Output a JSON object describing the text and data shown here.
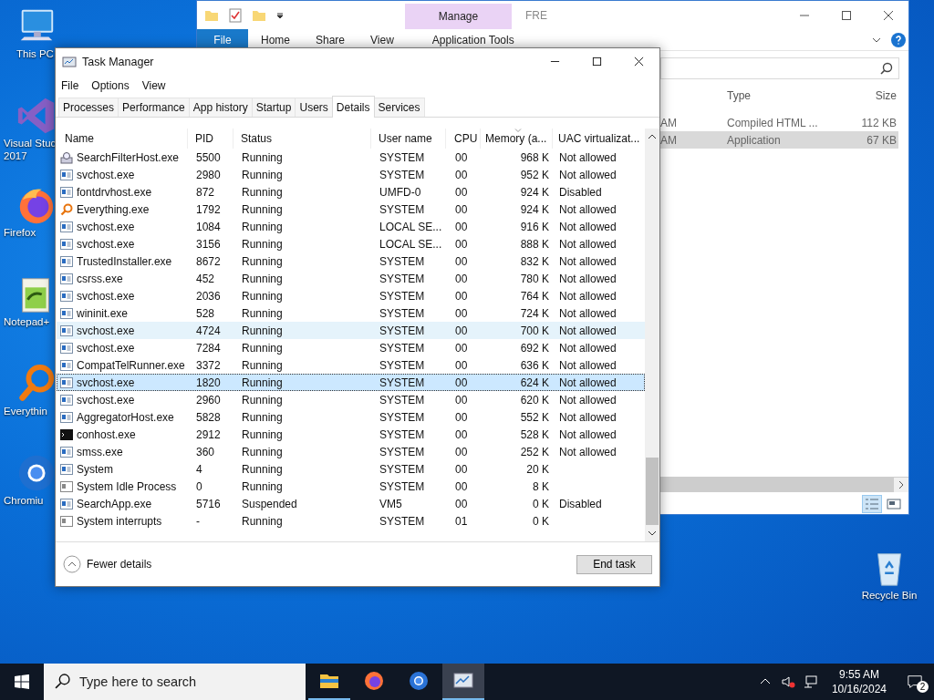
{
  "desktop_icons": [
    {
      "lines": [
        "This PC"
      ]
    },
    {
      "lines": [
        "Visual Stud",
        "2017"
      ]
    },
    {
      "lines": [
        "Firefox"
      ]
    },
    {
      "lines": [
        "Notepad+"
      ]
    },
    {
      "lines": [
        "Everythin"
      ]
    },
    {
      "lines": [
        "Chromiu"
      ]
    }
  ],
  "recycle_bin": {
    "label": "Recycle Bin"
  },
  "explorer": {
    "title": "FRE",
    "contextual_tab": "Manage",
    "ribbon_tabs": [
      {
        "label": "File",
        "kind": "file"
      },
      {
        "label": "Home",
        "kind": "plain"
      },
      {
        "label": "Share",
        "kind": "plain"
      },
      {
        "label": "View",
        "kind": "plain"
      },
      {
        "label": "Application Tools",
        "kind": "contextual"
      }
    ],
    "columns": [
      "Type",
      "Size"
    ],
    "rows": [
      {
        "modified": "AM",
        "type": "Compiled HTML ...",
        "size": "112 KB",
        "selected": false
      },
      {
        "modified": "AM",
        "type": "Application",
        "size": "67 KB",
        "selected": true
      }
    ]
  },
  "task_manager": {
    "title": "Task Manager",
    "menu": [
      "File",
      "Options",
      "View"
    ],
    "tabs": [
      {
        "label": "Processes",
        "selected": false
      },
      {
        "label": "Performance",
        "selected": false
      },
      {
        "label": "App history",
        "selected": false
      },
      {
        "label": "Startup",
        "selected": false
      },
      {
        "label": "Users",
        "selected": false
      },
      {
        "label": "Details",
        "selected": true
      },
      {
        "label": "Services",
        "selected": false
      }
    ],
    "columns": [
      "Name",
      "PID",
      "Status",
      "User name",
      "CPU",
      "Memory (a...",
      "UAC virtualizat..."
    ],
    "rows": [
      {
        "kind": "search",
        "name": "SearchFilterHost.exe",
        "pid": "5500",
        "status": "Running",
        "user": "SYSTEM",
        "cpu": "00",
        "memory": "968 K",
        "uac": "Not allowed",
        "selected": false,
        "hovered": false
      },
      {
        "kind": "app",
        "name": "svchost.exe",
        "pid": "2980",
        "status": "Running",
        "user": "SYSTEM",
        "cpu": "00",
        "memory": "952 K",
        "uac": "Not allowed",
        "selected": false,
        "hovered": false
      },
      {
        "kind": "app",
        "name": "fontdrvhost.exe",
        "pid": "872",
        "status": "Running",
        "user": "UMFD-0",
        "cpu": "00",
        "memory": "924 K",
        "uac": "Disabled",
        "selected": false,
        "hovered": false
      },
      {
        "kind": "everything",
        "name": "Everything.exe",
        "pid": "1792",
        "status": "Running",
        "user": "SYSTEM",
        "cpu": "00",
        "memory": "924 K",
        "uac": "Not allowed",
        "selected": false,
        "hovered": false
      },
      {
        "kind": "app",
        "name": "svchost.exe",
        "pid": "1084",
        "status": "Running",
        "user": "LOCAL SE...",
        "cpu": "00",
        "memory": "916 K",
        "uac": "Not allowed",
        "selected": false,
        "hovered": false
      },
      {
        "kind": "app",
        "name": "svchost.exe",
        "pid": "3156",
        "status": "Running",
        "user": "LOCAL SE...",
        "cpu": "00",
        "memory": "888 K",
        "uac": "Not allowed",
        "selected": false,
        "hovered": false
      },
      {
        "kind": "app",
        "name": "TrustedInstaller.exe",
        "pid": "8672",
        "status": "Running",
        "user": "SYSTEM",
        "cpu": "00",
        "memory": "832 K",
        "uac": "Not allowed",
        "selected": false,
        "hovered": false
      },
      {
        "kind": "app",
        "name": "csrss.exe",
        "pid": "452",
        "status": "Running",
        "user": "SYSTEM",
        "cpu": "00",
        "memory": "780 K",
        "uac": "Not allowed",
        "selected": false,
        "hovered": false
      },
      {
        "kind": "app",
        "name": "svchost.exe",
        "pid": "2036",
        "status": "Running",
        "user": "SYSTEM",
        "cpu": "00",
        "memory": "764 K",
        "uac": "Not allowed",
        "selected": false,
        "hovered": false
      },
      {
        "kind": "app",
        "name": "wininit.exe",
        "pid": "528",
        "status": "Running",
        "user": "SYSTEM",
        "cpu": "00",
        "memory": "724 K",
        "uac": "Not allowed",
        "selected": false,
        "hovered": false
      },
      {
        "kind": "app",
        "name": "svchost.exe",
        "pid": "4724",
        "status": "Running",
        "user": "SYSTEM",
        "cpu": "00",
        "memory": "700 K",
        "uac": "Not allowed",
        "selected": false,
        "hovered": true
      },
      {
        "kind": "app",
        "name": "svchost.exe",
        "pid": "7284",
        "status": "Running",
        "user": "SYSTEM",
        "cpu": "00",
        "memory": "692 K",
        "uac": "Not allowed",
        "selected": false,
        "hovered": false
      },
      {
        "kind": "app",
        "name": "CompatTelRunner.exe",
        "pid": "3372",
        "status": "Running",
        "user": "SYSTEM",
        "cpu": "00",
        "memory": "636 K",
        "uac": "Not allowed",
        "selected": false,
        "hovered": false
      },
      {
        "kind": "app",
        "name": "svchost.exe",
        "pid": "1820",
        "status": "Running",
        "user": "SYSTEM",
        "cpu": "00",
        "memory": "624 K",
        "uac": "Not allowed",
        "selected": true,
        "hovered": false
      },
      {
        "kind": "app",
        "name": "svchost.exe",
        "pid": "2960",
        "status": "Running",
        "user": "SYSTEM",
        "cpu": "00",
        "memory": "620 K",
        "uac": "Not allowed",
        "selected": false,
        "hovered": false
      },
      {
        "kind": "app",
        "name": "AggregatorHost.exe",
        "pid": "5828",
        "status": "Running",
        "user": "SYSTEM",
        "cpu": "00",
        "memory": "552 K",
        "uac": "Not allowed",
        "selected": false,
        "hovered": false
      },
      {
        "kind": "console",
        "name": "conhost.exe",
        "pid": "2912",
        "status": "Running",
        "user": "SYSTEM",
        "cpu": "00",
        "memory": "528 K",
        "uac": "Not allowed",
        "selected": false,
        "hovered": false
      },
      {
        "kind": "app",
        "name": "smss.exe",
        "pid": "360",
        "status": "Running",
        "user": "SYSTEM",
        "cpu": "00",
        "memory": "252 K",
        "uac": "Not allowed",
        "selected": false,
        "hovered": false
      },
      {
        "kind": "app",
        "name": "System",
        "pid": "4",
        "status": "Running",
        "user": "SYSTEM",
        "cpu": "00",
        "memory": "20 K",
        "selected": false,
        "hovered": false
      },
      {
        "kind": "system",
        "name": "System Idle Process",
        "pid": "0",
        "status": "Running",
        "user": "SYSTEM",
        "cpu": "00",
        "memory": "8 K",
        "selected": false,
        "hovered": false
      },
      {
        "kind": "app",
        "name": "SearchApp.exe",
        "pid": "5716",
        "status": "Suspended",
        "user": "VM5",
        "cpu": "00",
        "memory": "0 K",
        "uac": "Disabled",
        "selected": false,
        "hovered": false
      },
      {
        "kind": "system",
        "name": "System interrupts",
        "pid": "-",
        "status": "Running",
        "user": "SYSTEM",
        "cpu": "01",
        "memory": "0 K",
        "selected": false,
        "hovered": false
      }
    ],
    "footer": {
      "toggle": "Fewer details",
      "end_task": "End task"
    }
  },
  "taskbar": {
    "search": {
      "placeholder": "Type here to search"
    },
    "apps": [
      {
        "running": true,
        "focused": false
      },
      {
        "running": false,
        "focused": false
      },
      {
        "running": false,
        "focused": false
      },
      {
        "running": true,
        "focused": true
      }
    ],
    "clock": {
      "time": "9:55 AM",
      "date": "10/16/2024"
    },
    "notifications": "2"
  }
}
